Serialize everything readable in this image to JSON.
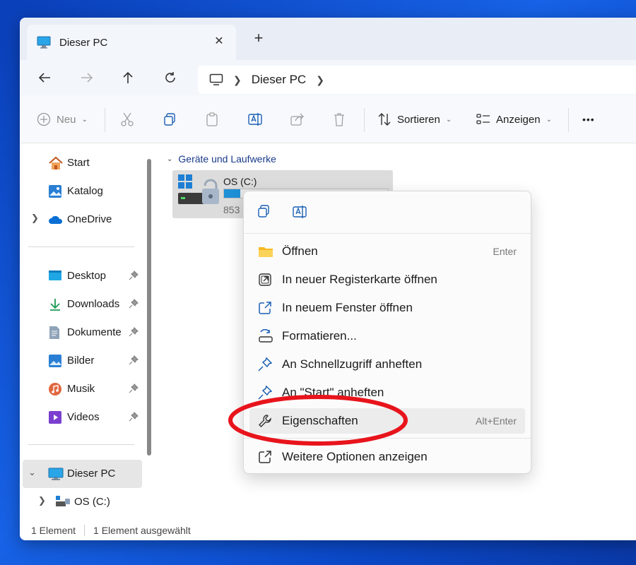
{
  "window": {
    "tab_title": "Dieser PC",
    "close_symbol": "✕",
    "new_tab_symbol": "+"
  },
  "address": {
    "path": "Dieser PC"
  },
  "toolbar": {
    "new_label": "Neu",
    "sort_label": "Sortieren",
    "view_label": "Anzeigen",
    "more_symbol": "•••"
  },
  "sidebar": {
    "items": [
      {
        "label": "Start",
        "icon": "home-icon"
      },
      {
        "label": "Katalog",
        "icon": "gallery-icon"
      },
      {
        "label": "OneDrive",
        "icon": "onedrive-icon"
      },
      {
        "label": "Desktop",
        "icon": "desktop-folder-icon"
      },
      {
        "label": "Downloads",
        "icon": "downloads-icon"
      },
      {
        "label": "Dokumente",
        "icon": "documents-icon"
      },
      {
        "label": "Bilder",
        "icon": "pictures-icon"
      },
      {
        "label": "Musik",
        "icon": "music-icon"
      },
      {
        "label": "Videos",
        "icon": "videos-icon"
      },
      {
        "label": "Dieser PC",
        "icon": "this-pc-icon"
      },
      {
        "label": "OS (C:)",
        "icon": "drive-icon"
      }
    ]
  },
  "content": {
    "group_header": "Geräte und Laufwerke",
    "drive": {
      "name": "OS (C:)",
      "usage_fraction": 0.1,
      "subtext": "853"
    }
  },
  "status": {
    "count": "1 Element",
    "selected": "1 Element ausgewählt"
  },
  "context_menu": {
    "items": [
      {
        "label": "Öffnen",
        "shortcut": "Enter",
        "icon": "folder-icon"
      },
      {
        "label": "In neuer Registerkarte öffnen",
        "shortcut": "",
        "icon": "open-new-tab-icon"
      },
      {
        "label": "In neuem Fenster öffnen",
        "shortcut": "",
        "icon": "open-new-window-icon"
      },
      {
        "label": "Formatieren...",
        "shortcut": "",
        "icon": "format-icon"
      },
      {
        "label": "An Schnellzugriff anheften",
        "shortcut": "",
        "icon": "pin-icon"
      },
      {
        "label": "An \"Start\" anheften",
        "shortcut": "",
        "icon": "pin-icon"
      },
      {
        "label": "Eigenschaften",
        "shortcut": "Alt+Enter",
        "icon": "wrench-icon"
      },
      {
        "label": "Weitere Optionen anzeigen",
        "shortcut": "",
        "icon": "more-options-icon"
      }
    ]
  },
  "colors": {
    "accent": "#0067c0",
    "highlight_circle": "#e8141c",
    "drive_bar": "#1e90d6"
  }
}
